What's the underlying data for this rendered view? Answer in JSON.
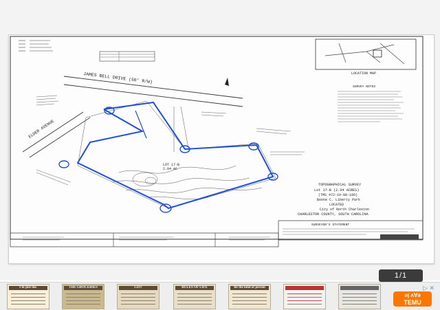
{
  "viewer": {
    "page_counter": "1/1"
  },
  "document": {
    "street_label": "JAMES BELL DRIVE (50' R/W)",
    "side_street_label": "ELDER AVENUE",
    "map_title": "LOCATION MAP",
    "notes_title": "SURVEY NOTES",
    "title_block": {
      "line1": "TOPOGRAPHICAL SURVEY",
      "line2": "Lot 17-B (2.04 ACRES)",
      "line3": "(TMS 472-10-00-196)",
      "line4": "Boone C. Liberty Park",
      "line5": "LOCATED",
      "line6": "City of North Charleston",
      "line7": "CHARLESTON COUNTY, SOUTH CAROLINA"
    },
    "statement_title": "SURVEYOR'S STATEMENT",
    "lot_label": "LOT 17-B",
    "lot_area": "2.04 AC"
  },
  "thumbnails": [
    {
      "caption": "I'm just me."
    },
    {
      "caption": "THE GROCERIES"
    },
    {
      "caption": "LIST"
    },
    {
      "caption": "RULES OF LIFE"
    },
    {
      "caption": "Be the kind of person"
    },
    {
      "caption": ""
    },
    {
      "caption": ""
    }
  ],
  "ad": {
    "adchoices": "▷ ✕",
    "brand_line1": "ǝן ʌ∀ǝ",
    "brand_line2": "TEMU"
  },
  "colors": {
    "ink": "#222222",
    "boundary": "#1f4fd6",
    "ad_orange": "#fb7701"
  }
}
